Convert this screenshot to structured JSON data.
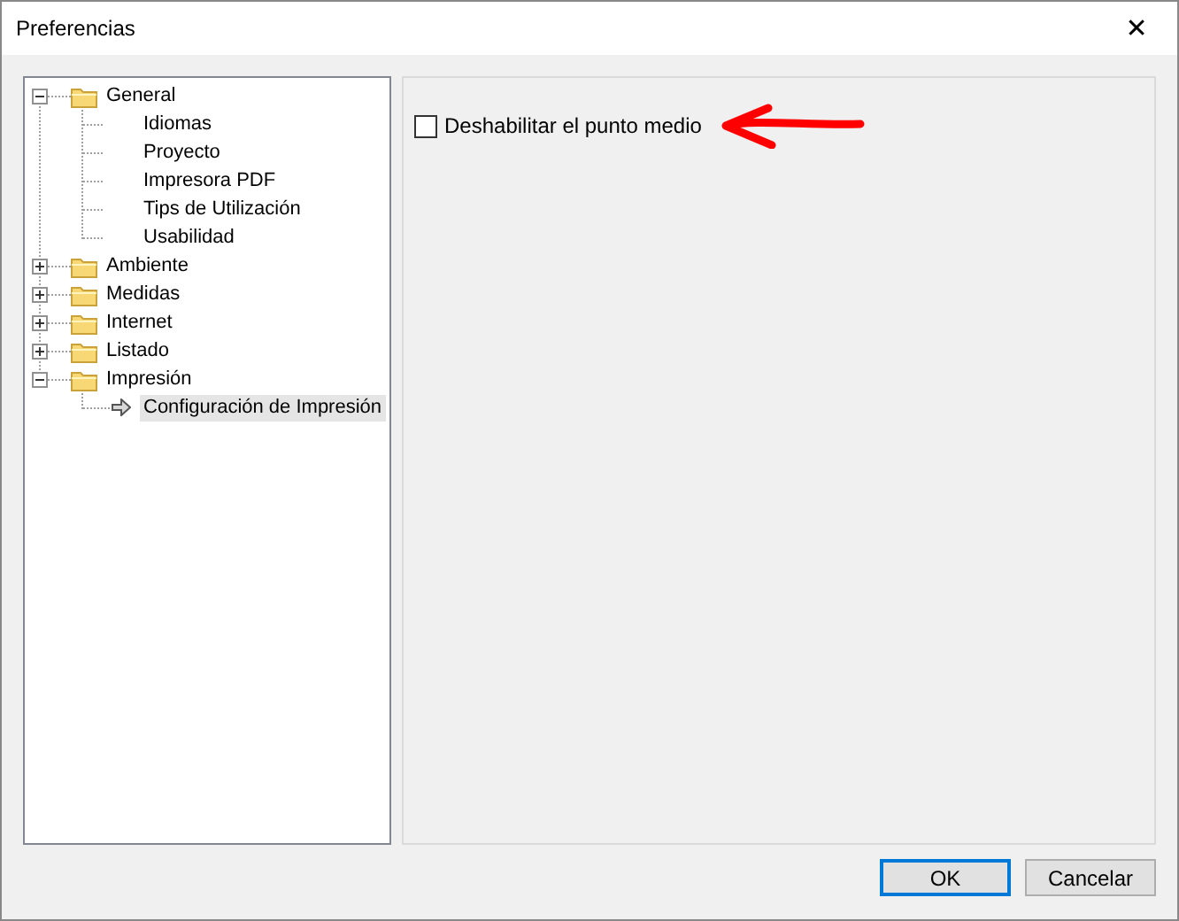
{
  "window": {
    "title": "Preferencias",
    "close": "✕"
  },
  "tree": {
    "items": [
      {
        "label": "General",
        "expanded": true,
        "children": [
          {
            "label": "Idiomas",
            "selected": false
          },
          {
            "label": "Proyecto",
            "selected": false
          },
          {
            "label": "Impresora PDF",
            "selected": false
          },
          {
            "label": "Tips de Utilización",
            "selected": false
          },
          {
            "label": "Usabilidad",
            "selected": false
          }
        ]
      },
      {
        "label": "Ambiente",
        "expanded": false
      },
      {
        "label": "Medidas",
        "expanded": false
      },
      {
        "label": "Internet",
        "expanded": false
      },
      {
        "label": "Listado",
        "expanded": false
      },
      {
        "label": "Impresión",
        "expanded": true,
        "children": [
          {
            "label": "Configuración de Impresión",
            "selected": true
          }
        ]
      }
    ]
  },
  "options": [
    {
      "label": "Deshabilitar el punto medio",
      "checked": false,
      "annotated": true
    }
  ],
  "buttons": [
    {
      "label": "OK",
      "default": true
    },
    {
      "label": "Cancelar",
      "default": false
    }
  ]
}
